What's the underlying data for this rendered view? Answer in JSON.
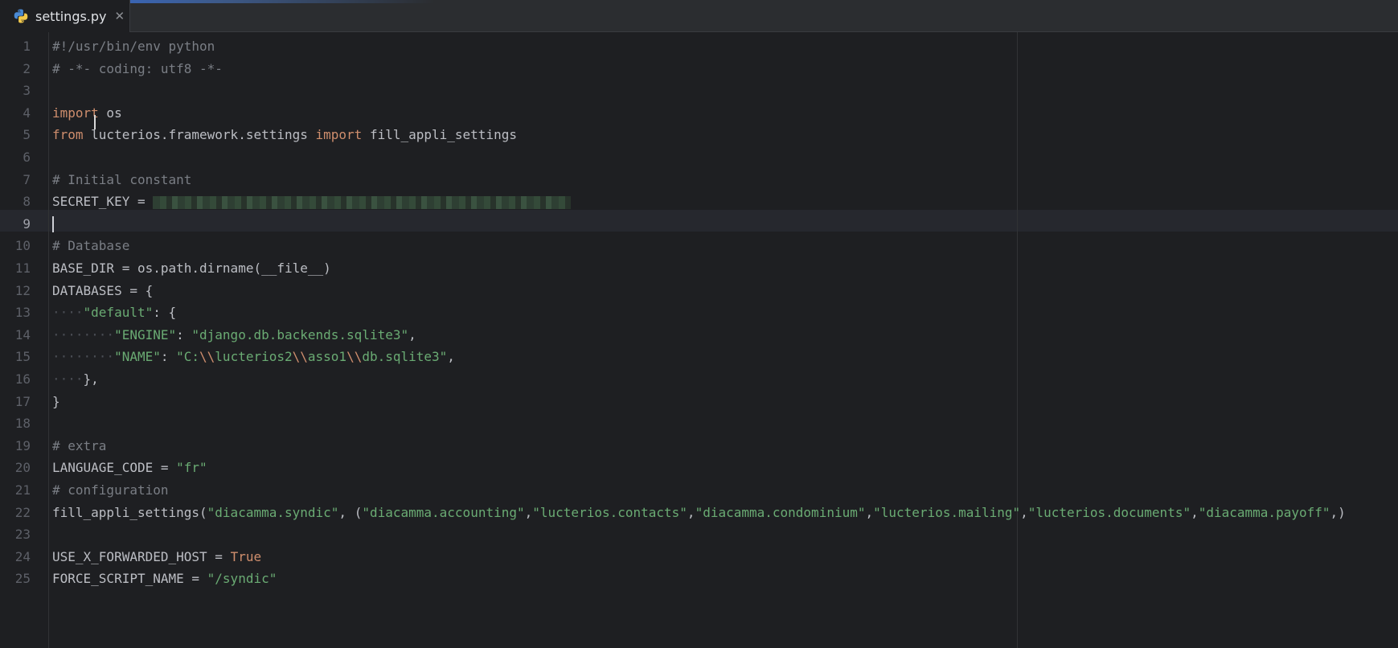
{
  "tab": {
    "filename": "settings.py",
    "close_glyph": "✕",
    "icon": "python-icon"
  },
  "editor": {
    "current_line": "9",
    "lines": [
      {
        "n": "1",
        "tokens": [
          {
            "t": "#!/usr/bin/env python",
            "c": "cm"
          }
        ]
      },
      {
        "n": "2",
        "tokens": [
          {
            "t": "# -*- coding: utf8 -*-",
            "c": "cm"
          }
        ]
      },
      {
        "n": "3",
        "tokens": []
      },
      {
        "n": "4",
        "tokens": [
          {
            "t": "import",
            "c": "kw"
          },
          {
            "t": " os",
            "c": ""
          }
        ]
      },
      {
        "n": "5",
        "tokens": [
          {
            "t": "from",
            "c": "kw"
          },
          {
            "t": " lucterios.framework.settings ",
            "c": ""
          },
          {
            "t": "import",
            "c": "kw"
          },
          {
            "t": " fill_appli_settings",
            "c": ""
          }
        ]
      },
      {
        "n": "6",
        "tokens": []
      },
      {
        "n": "7",
        "tokens": [
          {
            "t": "# Initial constant",
            "c": "cm"
          }
        ]
      },
      {
        "n": "8",
        "tokens": [
          {
            "t": "SECRET_KEY = ",
            "c": ""
          },
          {
            "t": "REDACTED",
            "c": "redact"
          }
        ]
      },
      {
        "n": "9",
        "tokens": [
          {
            "t": "",
            "c": "caret"
          }
        ]
      },
      {
        "n": "10",
        "tokens": [
          {
            "t": "# Database",
            "c": "cm"
          }
        ]
      },
      {
        "n": "11",
        "tokens": [
          {
            "t": "BASE_DIR = os.path.dirname(__file__)",
            "c": ""
          }
        ]
      },
      {
        "n": "12",
        "tokens": [
          {
            "t": "DATABASES = {",
            "c": ""
          }
        ]
      },
      {
        "n": "13",
        "tokens": [
          {
            "t": "····",
            "c": "ws"
          },
          {
            "t": "\"default\"",
            "c": "str"
          },
          {
            "t": ": {",
            "c": ""
          }
        ]
      },
      {
        "n": "14",
        "tokens": [
          {
            "t": "········",
            "c": "ws"
          },
          {
            "t": "\"ENGINE\"",
            "c": "str"
          },
          {
            "t": ": ",
            "c": ""
          },
          {
            "t": "\"django.db.backends.sqlite3\"",
            "c": "str"
          },
          {
            "t": ",",
            "c": ""
          }
        ]
      },
      {
        "n": "15",
        "tokens": [
          {
            "t": "········",
            "c": "ws"
          },
          {
            "t": "\"NAME\"",
            "c": "str"
          },
          {
            "t": ": ",
            "c": ""
          },
          {
            "t": "\"C:",
            "c": "str"
          },
          {
            "t": "\\\\",
            "c": "esc"
          },
          {
            "t": "lucterios2",
            "c": "str"
          },
          {
            "t": "\\\\",
            "c": "esc"
          },
          {
            "t": "asso1",
            "c": "str"
          },
          {
            "t": "\\\\",
            "c": "esc"
          },
          {
            "t": "db.sqlite3\"",
            "c": "str"
          },
          {
            "t": ",",
            "c": ""
          }
        ]
      },
      {
        "n": "16",
        "tokens": [
          {
            "t": "····",
            "c": "ws"
          },
          {
            "t": "},",
            "c": ""
          }
        ]
      },
      {
        "n": "17",
        "tokens": [
          {
            "t": "}",
            "c": ""
          }
        ]
      },
      {
        "n": "18",
        "tokens": []
      },
      {
        "n": "19",
        "tokens": [
          {
            "t": "# extra",
            "c": "cm"
          }
        ]
      },
      {
        "n": "20",
        "tokens": [
          {
            "t": "LANGUAGE_CODE = ",
            "c": ""
          },
          {
            "t": "\"fr\"",
            "c": "str"
          }
        ]
      },
      {
        "n": "21",
        "tokens": [
          {
            "t": "# configuration",
            "c": "cm"
          }
        ]
      },
      {
        "n": "22",
        "tokens": [
          {
            "t": "fill_appli_settings(",
            "c": ""
          },
          {
            "t": "\"diacamma.syndic\"",
            "c": "str"
          },
          {
            "t": ", (",
            "c": ""
          },
          {
            "t": "\"diacamma.accounting\"",
            "c": "str"
          },
          {
            "t": ",",
            "c": ""
          },
          {
            "t": "\"lucterios.contacts\"",
            "c": "str"
          },
          {
            "t": ",",
            "c": ""
          },
          {
            "t": "\"diacamma.condominium\"",
            "c": "str"
          },
          {
            "t": ",",
            "c": ""
          },
          {
            "t": "\"lucterios.mailing\"",
            "c": "str"
          },
          {
            "t": ",",
            "c": ""
          },
          {
            "t": "\"lucterios.documents\"",
            "c": "str"
          },
          {
            "t": ",",
            "c": ""
          },
          {
            "t": "\"diacamma.payoff\"",
            "c": "str"
          },
          {
            "t": ",)",
            "c": ""
          }
        ]
      },
      {
        "n": "23",
        "tokens": []
      },
      {
        "n": "24",
        "tokens": [
          {
            "t": "USE_X_FORWARDED_HOST = ",
            "c": ""
          },
          {
            "t": "True",
            "c": "kw"
          }
        ]
      },
      {
        "n": "25",
        "tokens": [
          {
            "t": "FORCE_SCRIPT_NAME = ",
            "c": ""
          },
          {
            "t": "\"/syndic\"",
            "c": "str"
          }
        ]
      }
    ]
  },
  "colors": {
    "background": "#1e1f22",
    "keyword": "#cf8e6d",
    "string": "#6aab73",
    "comment": "#7a7e85",
    "text": "#bcbec4"
  }
}
